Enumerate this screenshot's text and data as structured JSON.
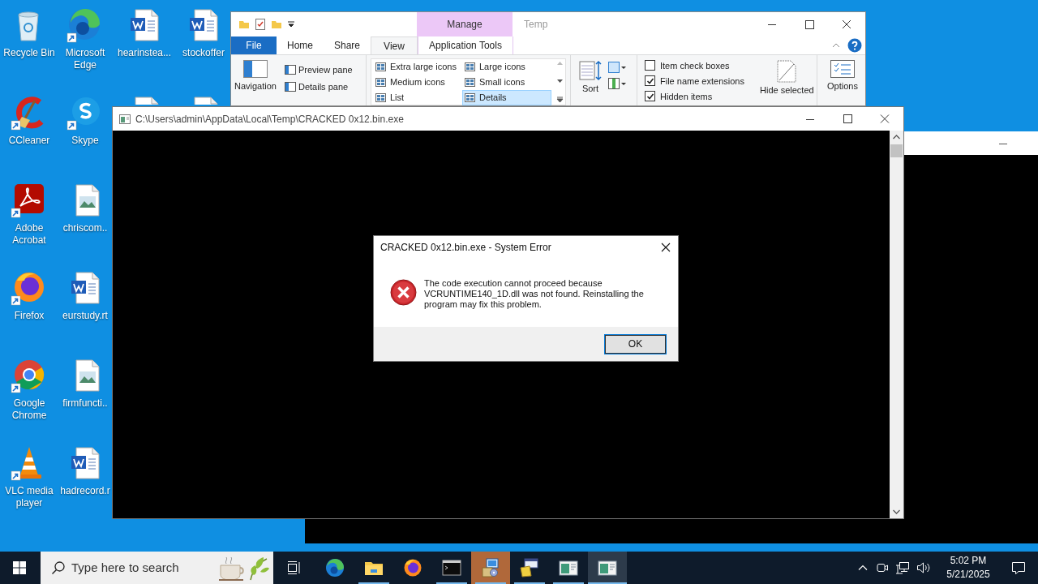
{
  "desktop": {
    "columns": [
      [
        {
          "kind": "recycle_bin",
          "label": "Recycle Bin",
          "shortcut": false
        },
        {
          "kind": "ccleaner",
          "label": "CCleaner",
          "shortcut": true
        },
        {
          "kind": "acrobat",
          "label": "Adobe Acrobat",
          "shortcut": true
        },
        {
          "kind": "firefox",
          "label": "Firefox",
          "shortcut": true
        },
        {
          "kind": "chrome",
          "label": "Google Chrome",
          "shortcut": true
        },
        {
          "kind": "vlc",
          "label": "VLC media player",
          "shortcut": true
        }
      ],
      [
        {
          "kind": "edge",
          "label": "Microsoft Edge",
          "shortcut": true
        },
        {
          "kind": "skype",
          "label": "Skype",
          "shortcut": true
        },
        {
          "kind": "image",
          "label": "chriscom..",
          "shortcut": false
        },
        {
          "kind": "word",
          "label": "eurstudy.rt",
          "shortcut": false
        },
        {
          "kind": "image",
          "label": "firmfuncti..",
          "shortcut": false
        },
        {
          "kind": "word",
          "label": "hadrecord.r",
          "shortcut": false
        }
      ],
      [
        {
          "kind": "word",
          "label": "hearinstea...",
          "shortcut": false
        },
        {
          "kind": "document"
        }
      ],
      [
        {
          "kind": "word",
          "label": "stockoffer",
          "shortcut": false
        },
        {
          "kind": "document"
        }
      ]
    ]
  },
  "explorer": {
    "context_tab": "Manage",
    "title": "Temp",
    "tabs": [
      {
        "label": "File",
        "kind": "file",
        "selected": false
      },
      {
        "label": "Home",
        "kind": "normal",
        "selected": false
      },
      {
        "label": "Share",
        "kind": "normal",
        "selected": false
      },
      {
        "label": "View",
        "kind": "normal",
        "selected": true
      },
      {
        "label": "Application Tools",
        "kind": "context",
        "selected": false
      }
    ],
    "ribbon": {
      "navigation_pane": "Navigation",
      "pane_buttons": [
        "Preview pane",
        "Details pane"
      ],
      "layouts": [
        {
          "label": "Extra large icons",
          "selected": false
        },
        {
          "label": "Large icons",
          "selected": false
        },
        {
          "label": "Medium icons",
          "selected": false
        },
        {
          "label": "Small icons",
          "selected": false
        },
        {
          "label": "List",
          "selected": false
        },
        {
          "label": "Details",
          "selected": true
        }
      ],
      "sort": "Sort",
      "show_hide": [
        {
          "label": "Item check boxes",
          "checked": false
        },
        {
          "label": "File name extensions",
          "checked": true
        },
        {
          "label": "Hidden items",
          "checked": true
        }
      ],
      "hide_selected": "Hide selected",
      "options": "Options"
    }
  },
  "console": {
    "title": "C:\\Users\\admin\\AppData\\Local\\Temp\\CRACKED 0x12.bin.exe"
  },
  "dialog": {
    "title": "CRACKED 0x12.bin.exe - System Error",
    "message": "The code execution cannot proceed because VCRUNTIME140_1D.dll was not found. Reinstalling the program may fix this problem.",
    "button": "OK"
  },
  "taskbar": {
    "search_placeholder": "Type here to search",
    "apps": [
      {
        "kind": "edge",
        "running": false,
        "active": false,
        "flashing": false
      },
      {
        "kind": "folder",
        "running": true,
        "active": false,
        "flashing": false
      },
      {
        "kind": "firefox",
        "running": false,
        "active": false,
        "flashing": false
      },
      {
        "kind": "terminal",
        "running": true,
        "active": false,
        "flashing": false
      },
      {
        "kind": "installer",
        "running": true,
        "active": false,
        "flashing": true
      },
      {
        "kind": "setup",
        "running": true,
        "active": false,
        "flashing": false
      },
      {
        "kind": "window",
        "running": true,
        "active": false,
        "flashing": false
      },
      {
        "kind": "window",
        "running": true,
        "active": true,
        "flashing": false
      }
    ],
    "clock": {
      "time": "5:02 PM",
      "date": "5/21/2025"
    }
  }
}
